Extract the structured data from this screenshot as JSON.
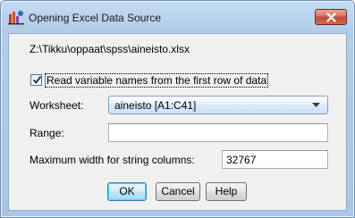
{
  "window": {
    "title": "Opening Excel Data Source",
    "close_label": "Close"
  },
  "file_path": "Z:\\Tikku\\oppaat\\spss\\aineisto.xlsx",
  "read_names": {
    "checked": true,
    "label": "Read variable names from the first row of data"
  },
  "worksheet": {
    "label": "Worksheet:",
    "value": "aineisto [A1:C41]"
  },
  "range": {
    "label": "Range:",
    "value": ""
  },
  "max_width": {
    "label": "Maximum width for string columns:",
    "value": "32767"
  },
  "buttons": {
    "ok": "OK",
    "cancel": "Cancel",
    "help": "Help"
  }
}
